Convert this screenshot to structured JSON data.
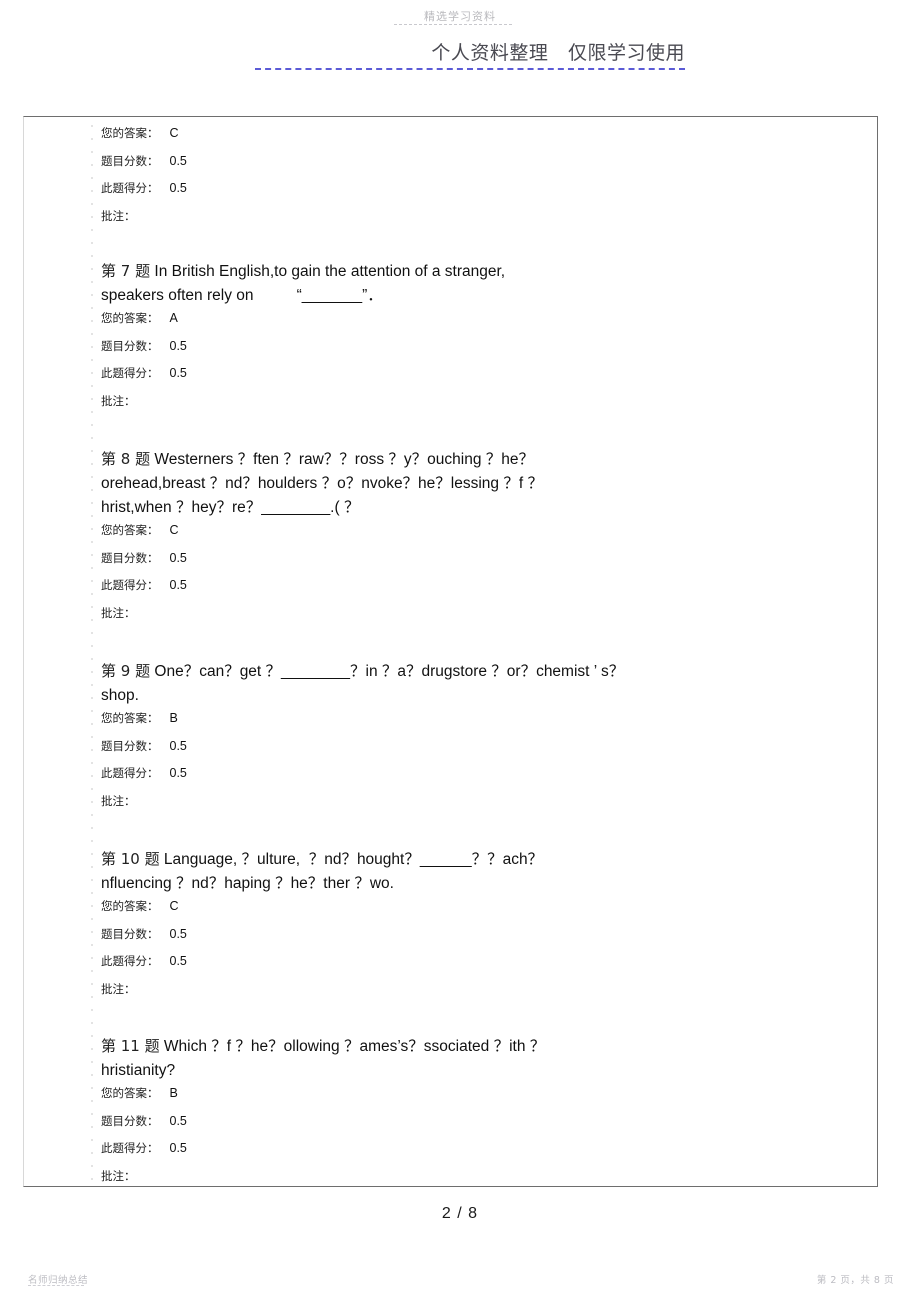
{
  "watermarks": {
    "top": "精选学习资料",
    "bottom_left": "名师归纳总结",
    "bottom_right": "第 2 页，共 8 页"
  },
  "header": {
    "title": "个人资料整理   仅限学习使用",
    "rule_color": "#5b5bd6"
  },
  "footer": {
    "page_indicator": "2 / 8"
  },
  "meta_labels": {
    "your_answer": "您的答案：",
    "question_score": "题目分数：",
    "score_obtained": "此题得分：",
    "annotation": "批注："
  },
  "blocks": [
    {
      "id": "q6-tail",
      "question": "",
      "your_answer": "C",
      "question_score": "0.5",
      "score_obtained": "0.5",
      "annotation": ""
    },
    {
      "id": "q7",
      "number_label": "第 7 题",
      "question": " In British English,to gain the attention of a stranger,\nspeakers often rely on          “_______”．",
      "your_answer": "A",
      "question_score": "0.5",
      "score_obtained": "0.5",
      "annotation": ""
    },
    {
      "id": "q8",
      "number_label": "第 8 题",
      "question": " Westerners ？ften ？raw？？ross ？y？ouching ？he？\norehead,breast ？nd？houlders ？o？nvoke？he？lessing ？f ？\nhrist,when ？hey？re？________.( ？",
      "your_answer": "C",
      "question_score": "0.5",
      "score_obtained": "0.5",
      "annotation": ""
    },
    {
      "id": "q9",
      "number_label": "第 9 题",
      "question": " One？can？get ？________？in ？a？drugstore ？or？chemist ’ s？\nshop.",
      "your_answer": "B",
      "question_score": "0.5",
      "score_obtained": "0.5",
      "annotation": ""
    },
    {
      "id": "q10",
      "number_label": "第 10 题",
      "question": " Language, ？ulture,  ？nd？hought？______？？ach？\nnfluencing ？nd？haping ？he？ther ？wo.",
      "your_answer": "C",
      "question_score": "0.5",
      "score_obtained": "0.5",
      "annotation": ""
    },
    {
      "id": "q11",
      "number_label": "第 11 题",
      "question": " Which ？f ？he？ollowing ？ames’s？ssociated ？ith ？\nhristianity?",
      "your_answer": "B",
      "question_score": "0.5",
      "score_obtained": "0.5",
      "annotation": ""
    }
  ]
}
